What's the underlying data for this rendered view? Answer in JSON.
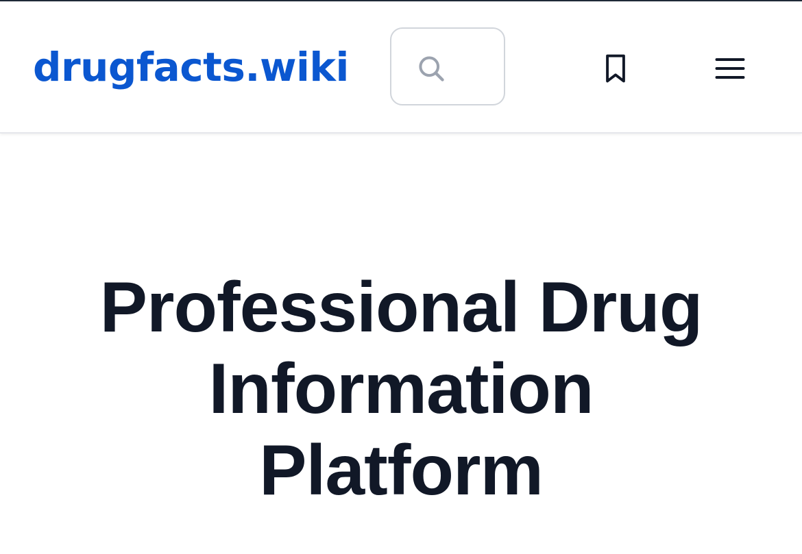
{
  "header": {
    "logo_text": "drugfacts.wiki",
    "search": {
      "icon": "search-icon"
    },
    "bookmark_icon": "bookmark-icon",
    "menu_icon": "hamburger-menu-icon"
  },
  "hero": {
    "title": "Professional Drug Information Platform"
  },
  "colors": {
    "brand": "#0b57d0",
    "title": "#111827",
    "border": "#d1d5db"
  }
}
